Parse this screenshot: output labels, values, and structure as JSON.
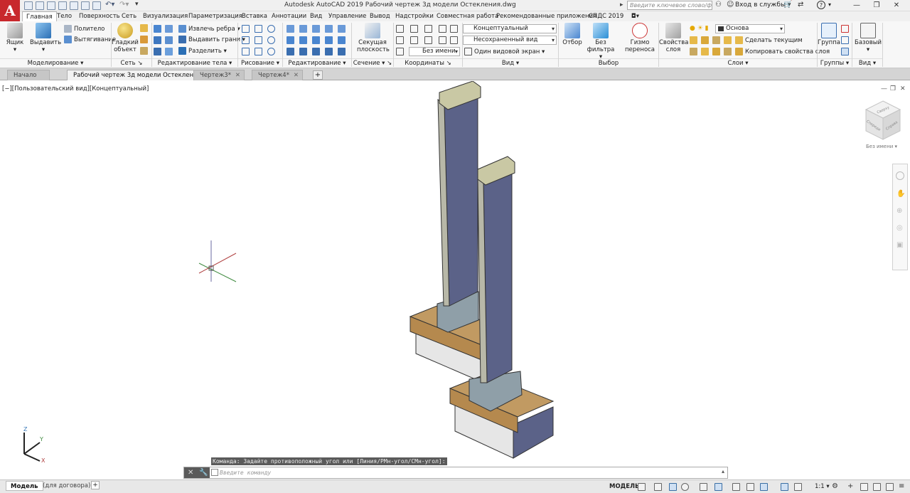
{
  "app": {
    "logo_letter": "A",
    "window_title": "Autodesk AutoCAD 2019   Рабочий чертеж 3д модели Остекления.dwg",
    "search_placeholder": "Введите ключевое слово/фразу",
    "sign_in": "Вход в службы",
    "help": "?"
  },
  "menu_tabs": [
    "Главная",
    "Тело",
    "Поверхность",
    "Сеть",
    "Визуализация",
    "Параметризация",
    "Вставка",
    "Аннотации",
    "Вид",
    "Управление",
    "Вывод",
    "Надстройки",
    "Совместная работа",
    "Рекомендованные приложения",
    "СПДС 2019"
  ],
  "ribbon": {
    "modeling": {
      "box": "Ящик",
      "extrude": "Выдавить",
      "polysolid": "Политело",
      "presspull": "Вытягивание",
      "footer": "Моделирование"
    },
    "mesh": {
      "smooth": "Гладкий объект",
      "footer": "Сеть"
    },
    "solid_edit": {
      "extract_edges": "Извлечь ребра",
      "extrude_faces": "Выдавить грани",
      "separate": "Разделить",
      "footer": "Редактирование тела"
    },
    "draw": {
      "footer": "Рисование"
    },
    "modify": {
      "footer": "Редактирование"
    },
    "section": {
      "section_plane": "Секущая плоскость",
      "footer": "Сечение"
    },
    "coordinates": {
      "unnamed": "Без имени",
      "footer": "Координаты"
    },
    "view": {
      "visual_style": "Концептуальный",
      "saved_view": "Несохраненный вид",
      "viewport": "Один видовой экран",
      "footer": "Вид"
    },
    "selection": {
      "culling": "Отбор",
      "no_filter": "Без фильтра",
      "gizmo": "Гизмо переноса",
      "footer": "Выбор"
    },
    "layers": {
      "layer_props": "Свойства слоя",
      "layer_name": "Основа",
      "make_current": "Сделать текущим",
      "match_layer": "Копировать свойства слоя",
      "footer": "Слои"
    },
    "groups": {
      "group": "Группа",
      "footer": "Группы"
    },
    "view2": {
      "base": "Базовый",
      "footer": "Вид"
    }
  },
  "doc_tabs": [
    {
      "label": "Начало",
      "active": false
    },
    {
      "label": "Рабочий чертеж 3д модели Остекления*",
      "active": true
    },
    {
      "label": "Чертеж3*",
      "active": false
    },
    {
      "label": "Чертеж4*",
      "active": false
    }
  ],
  "viewport": {
    "label": "[−][Пользовательский вид][Концептуальный]",
    "viewcube_top": "Сверху",
    "viewcube_left": "Спереди",
    "viewcube_right": "Справа",
    "viewcube_label": "Без имени",
    "ucs_x": "X",
    "ucs_y": "Y",
    "ucs_z": "Z"
  },
  "command": {
    "history": "Команда: Задайте противоположный угол или [Линия/РМн-угол/СМн-угол]:",
    "placeholder": "Введите команду"
  },
  "status": {
    "tabs": [
      "Модель",
      "(для договора)"
    ],
    "model_label": "МОДЕЛЬ",
    "scale": "1:1"
  },
  "colors": {
    "accent_red": "#c8282d",
    "glass": "#5b6288",
    "wood": "#c19a62",
    "concrete": "#e6e6e6"
  }
}
